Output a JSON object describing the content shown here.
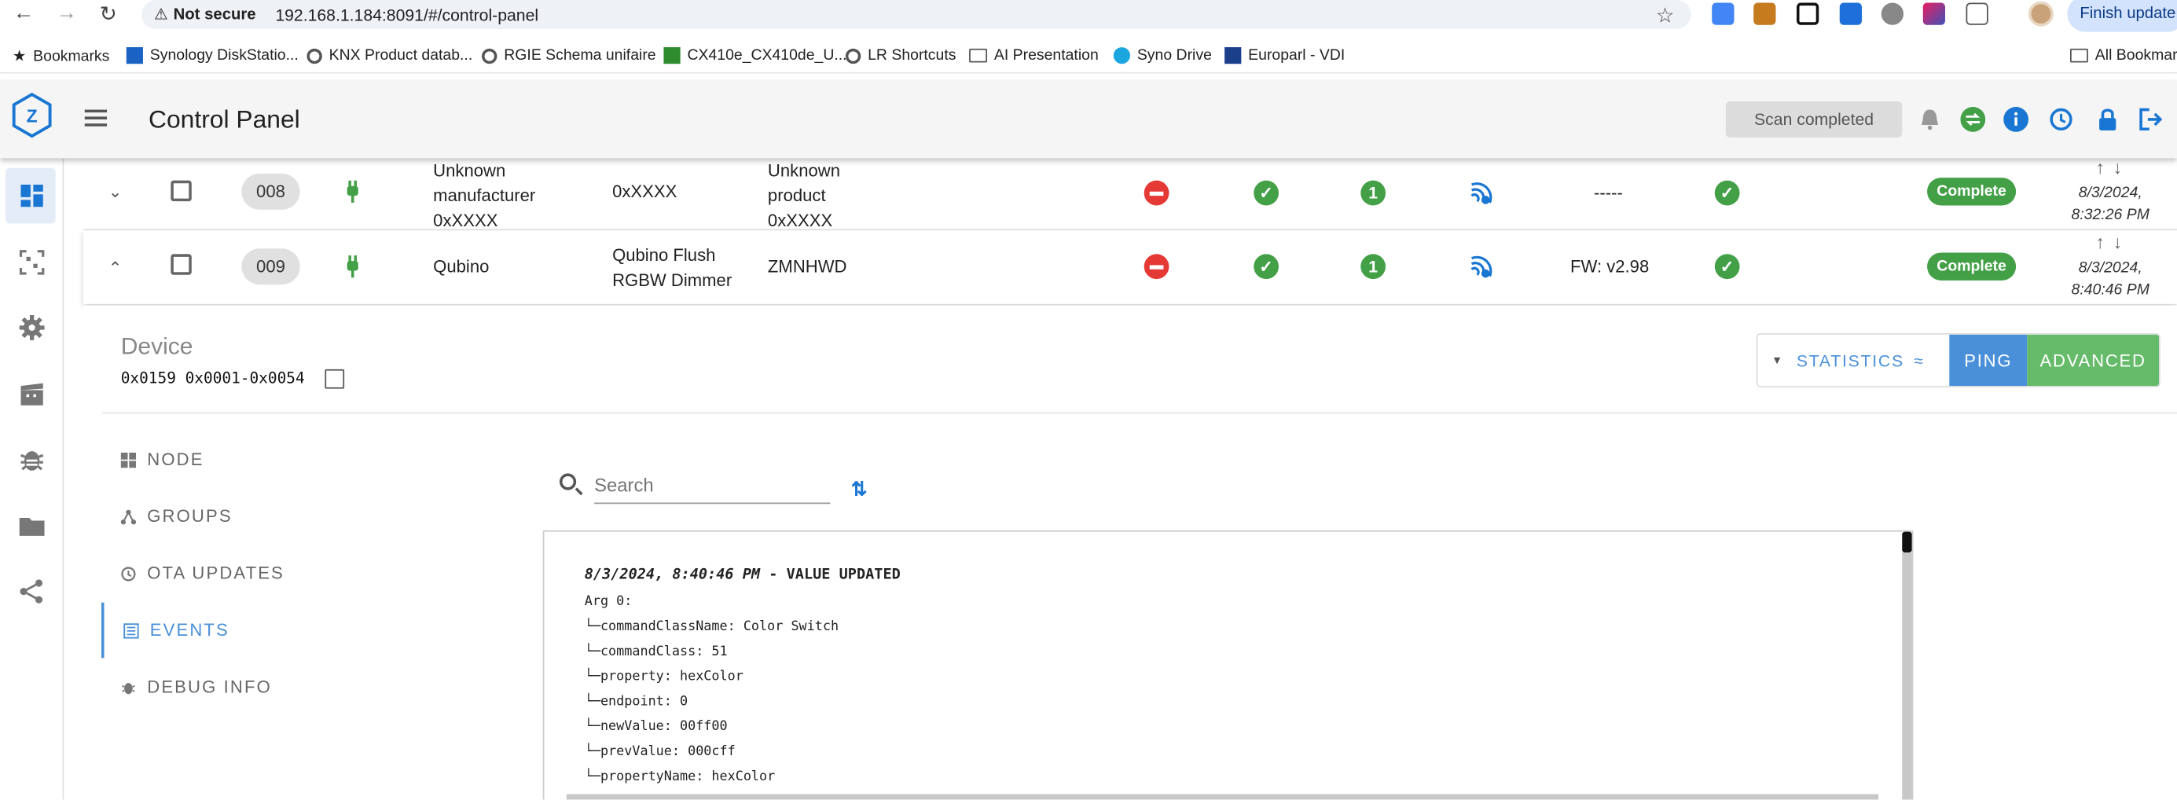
{
  "browser": {
    "url_warning": "Not secure",
    "url": "192.168.1.184:8091/#/control-panel",
    "finish_update": "Finish update",
    "bookmarks": [
      "Bookmarks",
      "Synology DiskStatio...",
      "KNX Product datab...",
      "RGIE Schema unifaire",
      "CX410e_CX410de_U...",
      "LR Shortcuts",
      "AI Presentation",
      "Syno Drive",
      "Europarl - VDI",
      "All Bookmarks"
    ]
  },
  "appbar": {
    "title": "Control Panel",
    "scan_status": "Scan completed"
  },
  "rows": [
    {
      "id": "008",
      "manufacturer": "Unknown manufacturer 0xXXXX",
      "manufacturer_lines": [
        "Unknown",
        "manufacturer",
        "0xXXXX"
      ],
      "product_lines": [
        "0xXXXX"
      ],
      "code_lines": [
        "Unknown",
        "product",
        "0xXXXX"
      ],
      "security_count": "1",
      "firmware": "-----",
      "status": "Complete",
      "date_lines": [
        "8/3/2024,",
        "8:32:26 PM"
      ]
    },
    {
      "id": "009",
      "manufacturer_lines": [
        "Qubino"
      ],
      "product_lines": [
        "Qubino Flush",
        "RGBW Dimmer"
      ],
      "code_lines": [
        "ZMNHWD"
      ],
      "security_count": "1",
      "firmware": "FW: v2.98",
      "status": "Complete",
      "date_lines": [
        "8/3/2024,",
        "8:40:46 PM"
      ]
    }
  ],
  "panel": {
    "title": "Device",
    "ids": "0x0159 0x0001-0x0054",
    "buttons": {
      "statistics": "STATISTICS",
      "ping": "PING",
      "advanced": "ADVANCED"
    },
    "tabs": [
      "NODE",
      "GROUPS",
      "OTA UPDATES",
      "EVENTS",
      "DEBUG INFO"
    ],
    "active_tab": "EVENTS",
    "search_placeholder": "Search",
    "log": {
      "timestamp": "8/3/2024, 8:40:46 PM",
      "event": " - VALUE UPDATED",
      "lines": [
        "Arg 0:",
        "└─commandClassName: Color Switch",
        "└─commandClass: 51",
        "└─property: hexColor",
        "└─endpoint: 0",
        "└─newValue: 00ff00",
        "└─prevValue: 000cff",
        "└─propertyName: hexColor"
      ]
    }
  },
  "colors": {
    "accent": "#4a90d9",
    "success": "#43a047",
    "danger": "#e53935"
  }
}
